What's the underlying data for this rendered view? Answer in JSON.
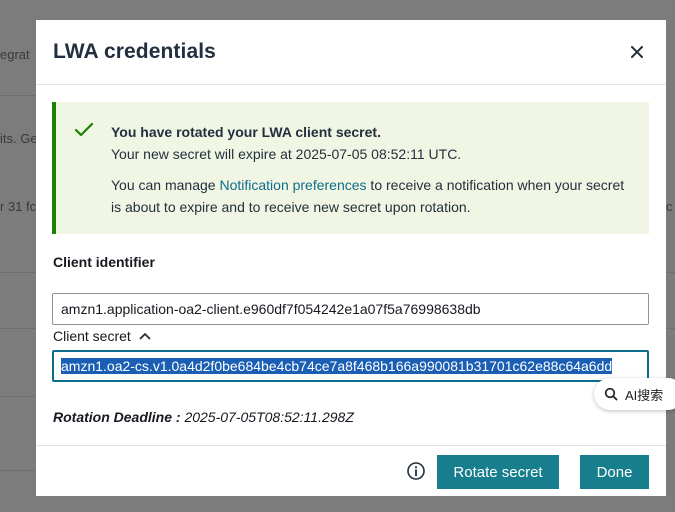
{
  "background": {
    "fragments": [
      "egrat",
      "its. Ge",
      "r 31 fc",
      "c"
    ]
  },
  "modal": {
    "title": "LWA credentials",
    "alert": {
      "title": "You have rotated your LWA client secret.",
      "expiry_text": "Your new secret will expire at 2025-07-05 08:52:11 UTC.",
      "manage_prefix": "You can manage ",
      "manage_link": "Notification preferences",
      "manage_suffix": " to receive a notification when your secret is about to expire and to receive new secret upon rotation."
    },
    "client_identifier": {
      "label": "Client identifier",
      "value": "amzn1.application-oa2-client.e960df7f054242e1a07f5a76998638db"
    },
    "client_secret": {
      "label": "Client secret",
      "value": "amzn1.oa2-cs.v1.0a4d2f0be684be4cb74ce7a8f468b166a990081b31701c62e88c64a6dd"
    },
    "rotation_deadline": {
      "label": "Rotation Deadline :",
      "value": "2025-07-05T08:52:11.298Z"
    },
    "footer": {
      "rotate_label": "Rotate secret",
      "done_label": "Done"
    }
  },
  "ai_chip": {
    "label": "AI搜索"
  },
  "colors": {
    "primary_button": "#177e8e",
    "success_border": "#1d8102",
    "alert_bg": "#f1f6e4",
    "link": "#0e6d8c"
  },
  "icons": [
    "close-icon",
    "check-icon",
    "chevron-up-icon",
    "info-icon",
    "search-icon"
  ]
}
